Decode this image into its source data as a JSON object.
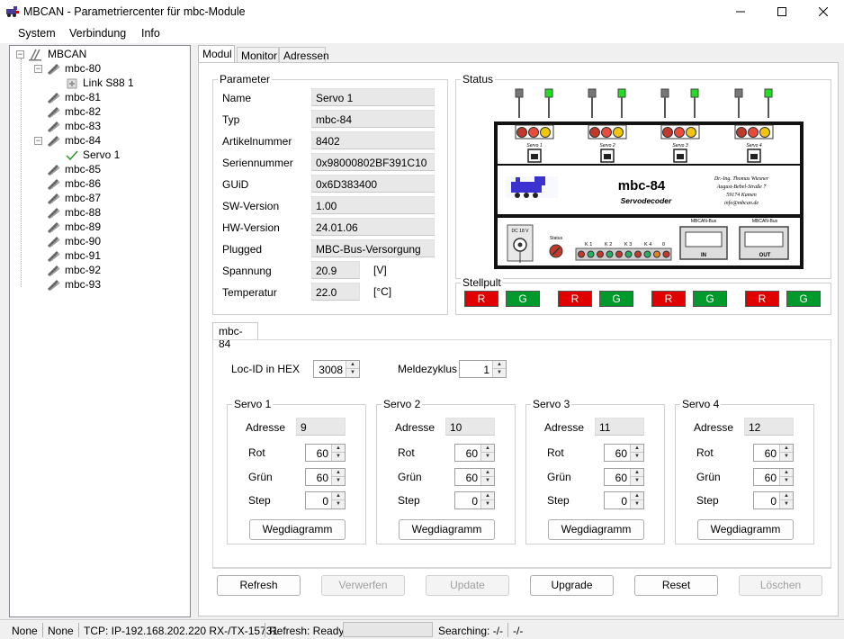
{
  "window": {
    "title": "MBCAN - Parametriercenter für mbc-Module"
  },
  "menu": [
    "System",
    "Verbindung",
    "Info"
  ],
  "tree": {
    "root": "MBCAN",
    "items": [
      {
        "label": "mbc-80",
        "level": 1,
        "expanded": true
      },
      {
        "label": "Link S88 1",
        "level": 2
      },
      {
        "label": "mbc-81",
        "level": 1
      },
      {
        "label": "mbc-82",
        "level": 1
      },
      {
        "label": "mbc-83",
        "level": 1
      },
      {
        "label": "mbc-84",
        "level": 1,
        "expanded": true
      },
      {
        "label": "Servo 1",
        "level": 2,
        "checked": true
      },
      {
        "label": "mbc-85",
        "level": 1
      },
      {
        "label": "mbc-86",
        "level": 1
      },
      {
        "label": "mbc-87",
        "level": 1
      },
      {
        "label": "mbc-88",
        "level": 1
      },
      {
        "label": "mbc-89",
        "level": 1
      },
      {
        "label": "mbc-90",
        "level": 1
      },
      {
        "label": "mbc-91",
        "level": 1
      },
      {
        "label": "mbc-92",
        "level": 1
      },
      {
        "label": "mbc-93",
        "level": 1
      }
    ]
  },
  "tabs": [
    "Modul",
    "Monitor",
    "Adressen"
  ],
  "parameter": {
    "title": "Parameter",
    "rows": [
      {
        "label": "Name",
        "value": "Servo 1"
      },
      {
        "label": "Typ",
        "value": "mbc-84"
      },
      {
        "label": "Artikelnummer",
        "value": "8402"
      },
      {
        "label": "Seriennummer",
        "value": "0x98000802BF391C10"
      },
      {
        "label": "GUiD",
        "value": "0x6D383400"
      },
      {
        "label": "SW-Version",
        "value": "1.00"
      },
      {
        "label": "HW-Version",
        "value": "24.01.06"
      },
      {
        "label": "Plugged",
        "value": "MBC-Bus-Versorgung"
      },
      {
        "label": "Spannung",
        "value": "20.9",
        "unit": "[V]"
      },
      {
        "label": "Temperatur",
        "value": "22.0",
        "unit": "[°C]"
      }
    ]
  },
  "status": {
    "title": "Status",
    "device": {
      "name": "mbc-84",
      "subtitle": "Servodecoder",
      "maker_lines": [
        "Dr.-Ing. Thomas Wiesner",
        "August-Bebel-Straße 7",
        "59174 Kamen",
        "info@mbcan.de"
      ],
      "servo_labels": [
        "Servo 1",
        "Servo 2",
        "Servo 3",
        "Servo 4"
      ],
      "dc_label": "DC 18 V",
      "status_label": "Status",
      "k_labels": [
        "K 1",
        "K 2",
        "K 3",
        "K 4",
        "0"
      ],
      "in_label": "IN",
      "out_label": "OUT",
      "bus_label": "MBCAN-Bus"
    }
  },
  "stellpult": {
    "title": "Stellpult",
    "buttons": [
      "R",
      "G",
      "R",
      "G",
      "R",
      "G",
      "R",
      "G"
    ]
  },
  "subtab": "mbc-84",
  "config": {
    "locid_label": "Loc-ID in HEX",
    "locid_value": "3008",
    "meldezyklus_label": "Meldezyklus",
    "meldezyklus_value": "1",
    "field_labels": {
      "adresse": "Adresse",
      "rot": "Rot",
      "gruen": "Grün",
      "step": "Step"
    },
    "weg_label": "Wegdiagramm",
    "servos": [
      {
        "title": "Servo 1",
        "adresse": "9",
        "rot": "60",
        "gruen": "60",
        "step": "0"
      },
      {
        "title": "Servo 2",
        "adresse": "10",
        "rot": "60",
        "gruen": "60",
        "step": "0"
      },
      {
        "title": "Servo 3",
        "adresse": "11",
        "rot": "60",
        "gruen": "60",
        "step": "0"
      },
      {
        "title": "Servo 4",
        "adresse": "12",
        "rot": "60",
        "gruen": "60",
        "step": "0"
      }
    ]
  },
  "actions": [
    {
      "label": "Refresh",
      "enabled": true
    },
    {
      "label": "Verwerfen",
      "enabled": false
    },
    {
      "label": "Update",
      "enabled": false
    },
    {
      "label": "Upgrade",
      "enabled": true
    },
    {
      "label": "Reset",
      "enabled": true
    },
    {
      "label": "Löschen",
      "enabled": false
    }
  ],
  "statusbar": {
    "a": "None",
    "b": "None",
    "tcp": "TCP: IP-192.168.202.220 RX-/TX-15731",
    "refresh": "Refresh: Ready",
    "searching": "Searching: -/-",
    "last": "-/-"
  },
  "colors": {
    "accent": "#0078d7",
    "red": "#e00000",
    "green": "#009a2c",
    "led_green": "#22dd22"
  }
}
